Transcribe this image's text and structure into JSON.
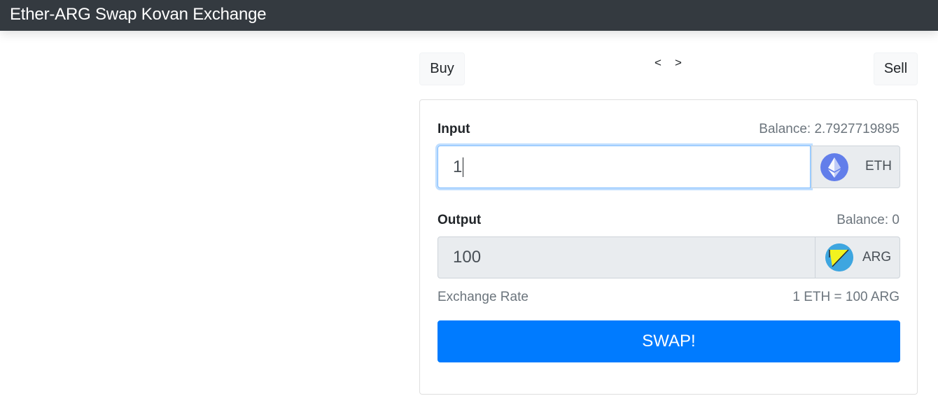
{
  "header": {
    "title": "Ether-ARG Swap Kovan Exchange"
  },
  "nav": {
    "buy_label": "Buy",
    "sell_label": "Sell",
    "prev_label": "<",
    "next_label": ">"
  },
  "form": {
    "input": {
      "label": "Input",
      "balance": "Balance: 2.7927719895",
      "value": "1",
      "token_icon": "ethereum-icon",
      "token": "ETH"
    },
    "output": {
      "label": "Output",
      "balance": "Balance: 0",
      "value": "100",
      "token_icon": "arg-token-icon",
      "token": "ARG"
    },
    "rate_label": "Exchange Rate",
    "rate_value": "1 ETH = 100 ARG",
    "swap_label": "SWAP!"
  },
  "colors": {
    "navbar": "#343a40",
    "primary": "#007bff",
    "eth": "#627eea",
    "arg_blue": "#3ea6e0",
    "arg_yellow": "#f2f21f"
  }
}
